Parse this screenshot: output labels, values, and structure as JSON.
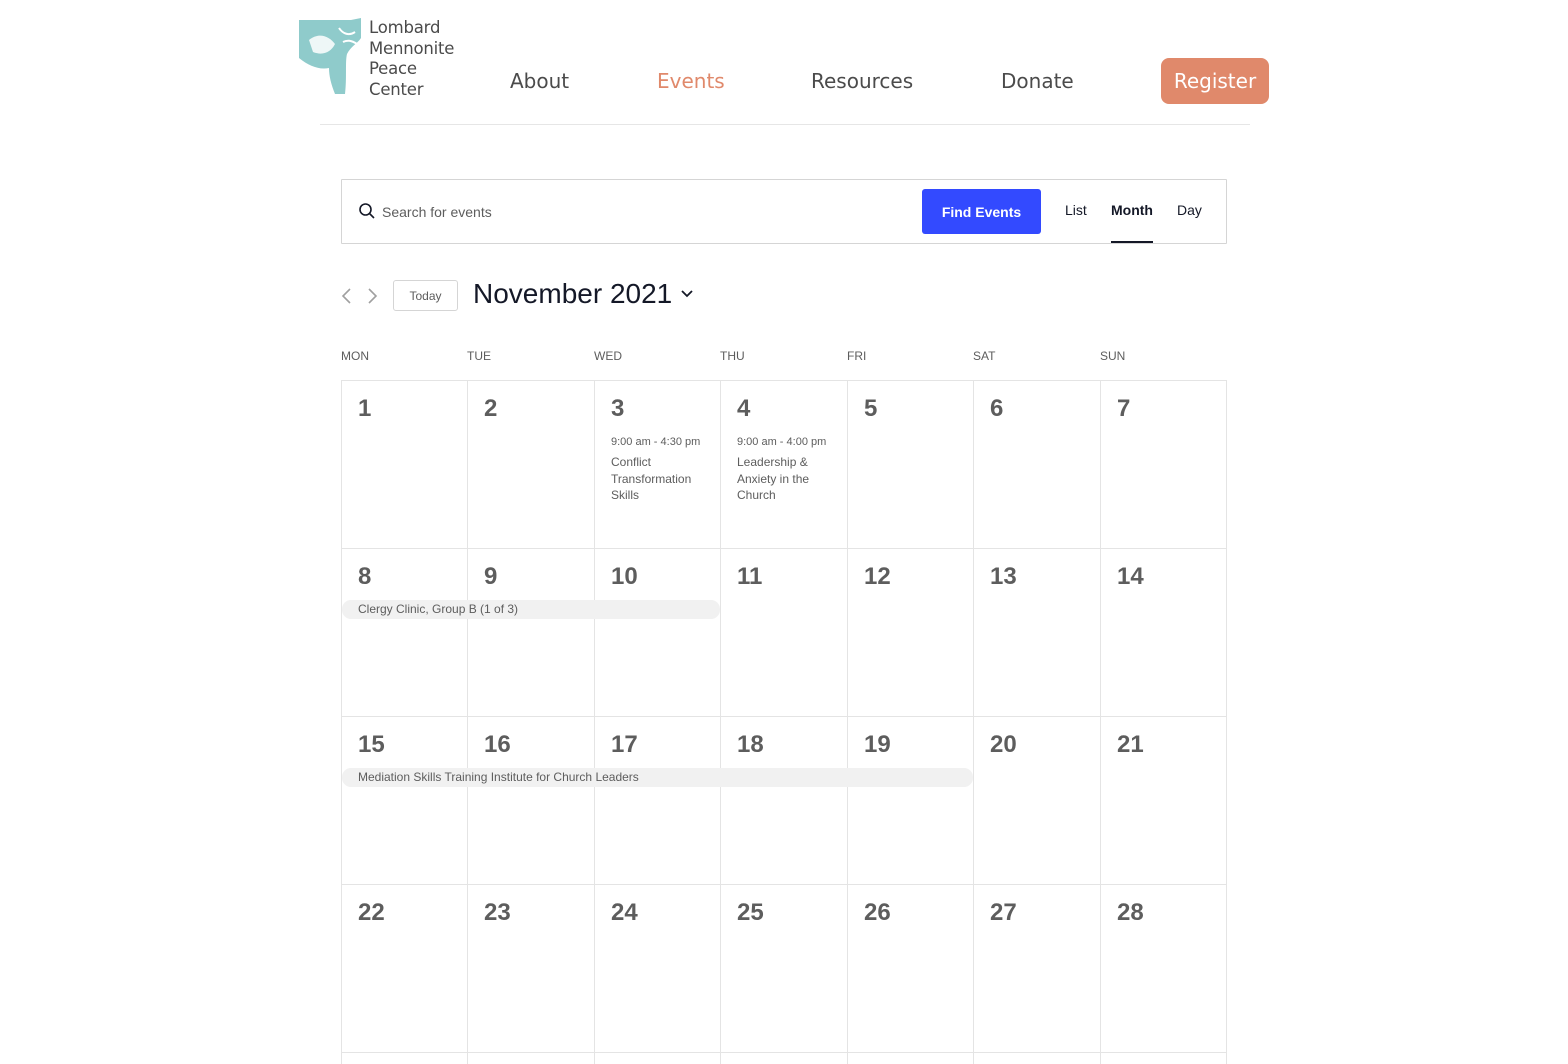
{
  "brand": {
    "logo_lines": [
      "Lombard",
      "Mennonite",
      "Peace",
      "Center"
    ],
    "accent": "#e0896b",
    "teal": "#8fcbcb"
  },
  "nav": {
    "about": "About",
    "events": "Events",
    "resources": "Resources",
    "donate": "Donate",
    "register": "Register"
  },
  "search": {
    "placeholder": "Search for events",
    "value": "",
    "find_label": "Find Events",
    "button_color": "#334aff"
  },
  "views": {
    "list": "List",
    "month": "Month",
    "day": "Day",
    "active": "Month"
  },
  "datenav": {
    "today": "Today",
    "title": "November 2021"
  },
  "weekdays": [
    "MON",
    "TUE",
    "WED",
    "THU",
    "FRI",
    "SAT",
    "SUN"
  ],
  "weeks": [
    [
      "1",
      "2",
      "3",
      "4",
      "5",
      "6",
      "7"
    ],
    [
      "8",
      "9",
      "10",
      "11",
      "12",
      "13",
      "14"
    ],
    [
      "15",
      "16",
      "17",
      "18",
      "19",
      "20",
      "21"
    ],
    [
      "22",
      "23",
      "24",
      "25",
      "26",
      "27",
      "28"
    ]
  ],
  "events": {
    "nov3": {
      "time": "9:00 am - 4:30 pm",
      "title": "Conflict Transformation Skills"
    },
    "nov4": {
      "time": "9:00 am - 4:00 pm",
      "title": "Leadership & Anxiety in the Church"
    },
    "clergy": "Clergy Clinic, Group B (1 of 3)",
    "mediation": "Mediation Skills Training Institute for Church Leaders"
  }
}
